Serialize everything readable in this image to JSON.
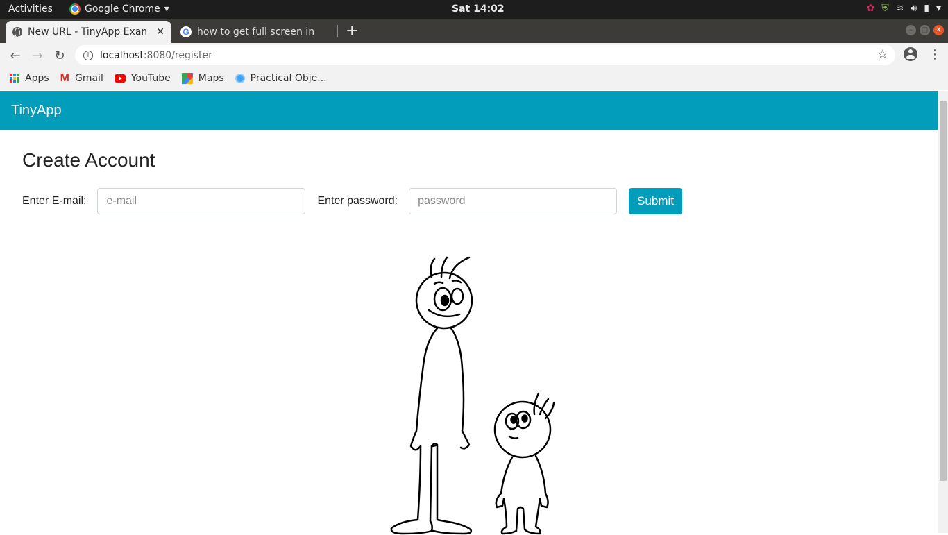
{
  "os_bar": {
    "activities": "Activities",
    "app_name": "Google Chrome",
    "clock": "Sat 14:02"
  },
  "tabs": [
    {
      "title": "New URL - TinyApp Example",
      "active": true,
      "icon": "globe-icon"
    },
    {
      "title": "how to get full screen in ubuntu",
      "active": false,
      "icon": "google-icon"
    }
  ],
  "address_bar": {
    "host": "localhost",
    "path": ":8080/register"
  },
  "bookmarks": [
    {
      "label": "Apps",
      "icon": "apps-grid-icon"
    },
    {
      "label": "Gmail",
      "icon": "gmail-icon"
    },
    {
      "label": "YouTube",
      "icon": "youtube-icon"
    },
    {
      "label": "Maps",
      "icon": "maps-icon"
    },
    {
      "label": "Practical Obje...",
      "icon": "practical-objects-icon"
    }
  ],
  "page": {
    "brand": "TinyApp",
    "heading": "Create Account",
    "form": {
      "email_label": "Enter E-mail:",
      "email_placeholder": "e-mail",
      "password_label": "Enter password:",
      "password_placeholder": "password",
      "submit_label": "Submit"
    }
  },
  "colors": {
    "navbar": "#029dbb",
    "submit": "#029dbb",
    "os_bar": "#1d1d1d",
    "tabstrip": "#3c3b37"
  }
}
